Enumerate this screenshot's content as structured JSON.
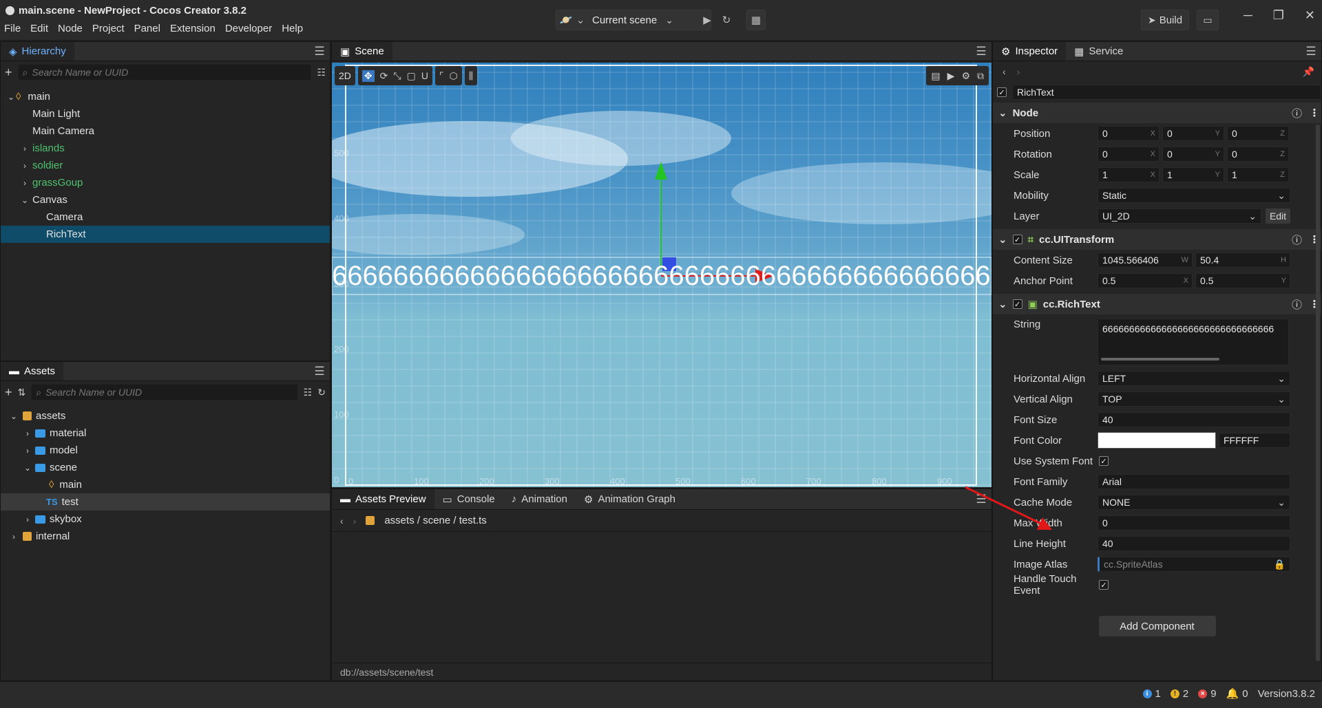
{
  "window": {
    "title": "main.scene - NewProject - Cocos Creator 3.8.2"
  },
  "menu": [
    "File",
    "Edit",
    "Node",
    "Project",
    "Panel",
    "Extension",
    "Developer",
    "Help"
  ],
  "toolbar": {
    "scene_select": "Current scene",
    "build_label": "Build"
  },
  "hierarchy": {
    "tab": "Hierarchy",
    "search_placeholder": "Search Name or UUID",
    "nodes": [
      {
        "label": "main",
        "depth": 0,
        "arrow": "down",
        "icon": "scene"
      },
      {
        "label": "Main Light",
        "depth": 1
      },
      {
        "label": "Main Camera",
        "depth": 1
      },
      {
        "label": "islands",
        "depth": 1,
        "arrow": "right",
        "prefab": true
      },
      {
        "label": "soldier",
        "depth": 1,
        "arrow": "right",
        "prefab": true
      },
      {
        "label": "grassGoup",
        "depth": 1,
        "arrow": "right",
        "prefab": true
      },
      {
        "label": "Canvas",
        "depth": 1,
        "arrow": "down"
      },
      {
        "label": "Camera",
        "depth": 2
      },
      {
        "label": "RichText",
        "depth": 2,
        "selected": true
      }
    ]
  },
  "assets": {
    "tab": "Assets",
    "search_placeholder": "Search Name or UUID",
    "items": [
      {
        "label": "assets",
        "depth": 0,
        "arrow": "down",
        "icon": "db"
      },
      {
        "label": "material",
        "depth": 1,
        "arrow": "right",
        "icon": "folder"
      },
      {
        "label": "model",
        "depth": 1,
        "arrow": "right",
        "icon": "folder"
      },
      {
        "label": "scene",
        "depth": 1,
        "arrow": "down",
        "icon": "folder-open"
      },
      {
        "label": "main",
        "depth": 2,
        "icon": "scene"
      },
      {
        "label": "test",
        "depth": 2,
        "icon": "ts",
        "selected": true
      },
      {
        "label": "skybox",
        "depth": 1,
        "arrow": "right",
        "icon": "folder"
      },
      {
        "label": "internal",
        "depth": 0,
        "arrow": "right",
        "icon": "db"
      }
    ]
  },
  "scene": {
    "tab": "Scene",
    "mode_2d": "2D",
    "rich_text": "6666666666666666666666666666666666666666666666",
    "y_ticks": [
      "500",
      "400",
      "300",
      "200",
      "100",
      "0"
    ],
    "x_ticks": [
      "0",
      "100",
      "200",
      "300",
      "400",
      "500",
      "600",
      "700",
      "800",
      "900"
    ]
  },
  "bottom": {
    "tabs": [
      "Assets Preview",
      "Console",
      "Animation",
      "Animation Graph"
    ],
    "breadcrumb": [
      "assets",
      "scene",
      "test.ts"
    ],
    "footer_path": "db://assets/scene/test"
  },
  "inspector": {
    "tabs": [
      "Inspector",
      "Service"
    ],
    "node_name": "RichText",
    "node_section": "Node",
    "position": [
      "0",
      "0",
      "0"
    ],
    "rotation": [
      "0",
      "0",
      "0"
    ],
    "scale": [
      "1",
      "1",
      "1"
    ],
    "axes": [
      "X",
      "Y",
      "Z"
    ],
    "mobility": "Static",
    "layer": "UI_2D",
    "edit_label": "Edit",
    "labels": {
      "position": "Position",
      "rotation": "Rotation",
      "scale": "Scale",
      "mobility": "Mobility",
      "layer": "Layer",
      "content_size": "Content Size",
      "anchor_point": "Anchor Point",
      "string": "String",
      "h_align": "Horizontal Align",
      "v_align": "Vertical Align",
      "font_size": "Font Size",
      "font_color": "Font Color",
      "use_system_font": "Use System Font",
      "font_family": "Font Family",
      "cache_mode": "Cache Mode",
      "max_width": "Max Width",
      "line_height": "Line Height",
      "image_atlas": "Image Atlas",
      "handle_touch": "Handle Touch Event"
    },
    "uitransform": {
      "title": "cc.UITransform",
      "width": "1045.566406",
      "height": "50.4",
      "w_ax": "W",
      "h_ax": "H",
      "anchor_x": "0.5",
      "anchor_y": "0.5"
    },
    "richtext": {
      "title": "cc.RichText",
      "string": "66666666666666666666666666666666",
      "h_align": "LEFT",
      "v_align": "TOP",
      "font_size": "40",
      "font_color_hex": "FFFFFF",
      "font_color": "#ffffff",
      "font_family": "Arial",
      "cache_mode": "NONE",
      "max_width": "0",
      "line_height": "40",
      "image_atlas_placeholder": "cc.SpriteAtlas"
    },
    "add_component": "Add Component"
  },
  "statusbar": {
    "info": "1",
    "warn": "2",
    "error": "9",
    "notify": "0",
    "version": "Version3.8.2"
  },
  "colors": {
    "accent": "#0e4c6a",
    "prefab": "#4fc26f",
    "link": "#6fb2ff"
  }
}
